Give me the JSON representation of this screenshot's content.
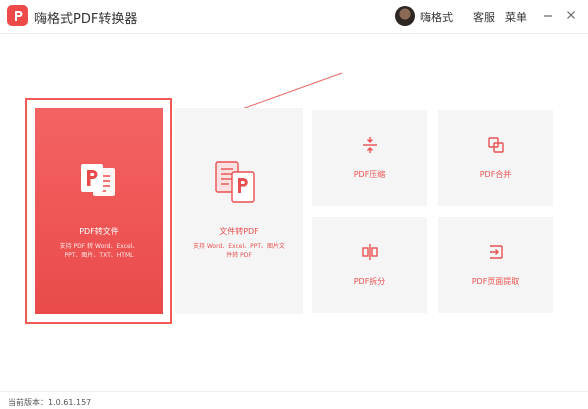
{
  "app": {
    "title": "嗨格式PDF转换器"
  },
  "header": {
    "username": "嗨格式",
    "service": "客服",
    "menu": "菜单",
    "minimize": "—",
    "close": "✕"
  },
  "main_card": {
    "title": "PDF转文件",
    "desc_line1": "支持 PDF 转 Word、Excel、",
    "desc_line2": "PPT、图片、TXT、HTML"
  },
  "secondary_card": {
    "title": "文件转PDF",
    "desc_line1": "支持 Word、Excel、PPT、图片文",
    "desc_line2": "件转 PDF"
  },
  "tiles": [
    {
      "label": "PDF压缩",
      "icon": "compress-icon"
    },
    {
      "label": "PDF合并",
      "icon": "merge-icon"
    },
    {
      "label": "PDF拆分",
      "icon": "split-icon"
    },
    {
      "label": "PDF页面提取",
      "icon": "extract-icon"
    }
  ],
  "footer": {
    "version": "当前版本：1.0.61.157"
  },
  "colors": {
    "accent": "#ea4a4a",
    "tile_bg": "#f5f5f5",
    "tile_text": "#ea5050"
  }
}
